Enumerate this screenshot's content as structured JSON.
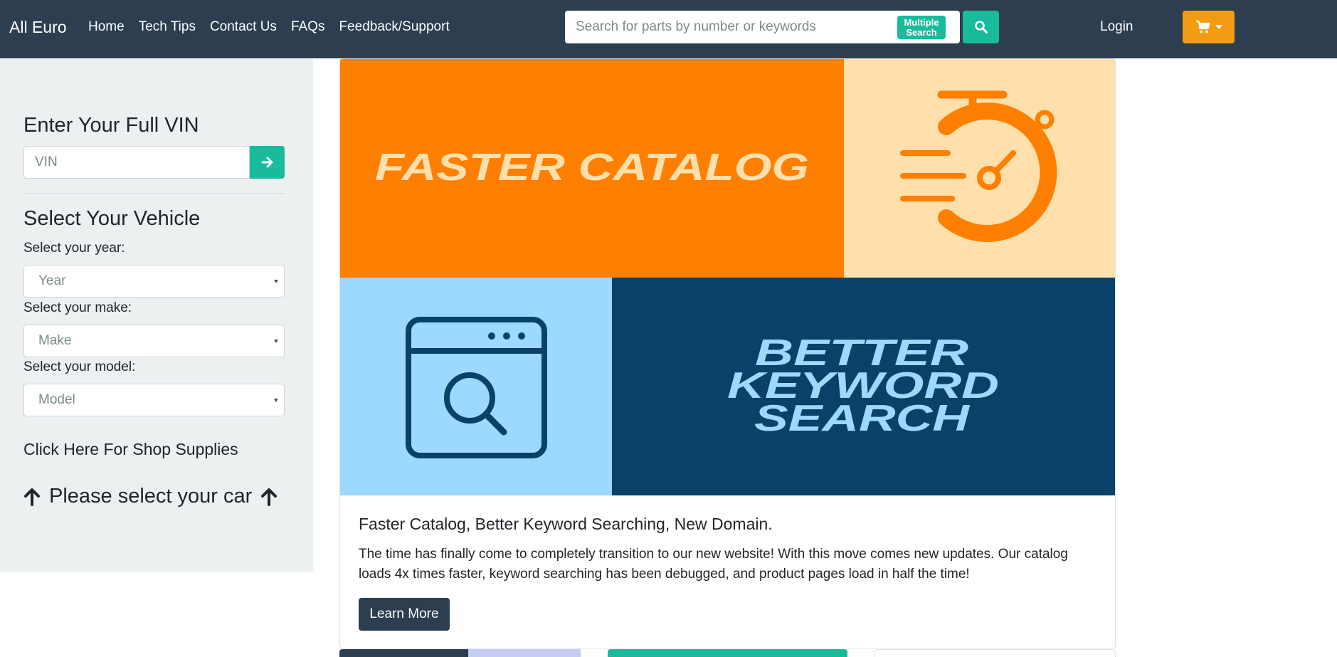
{
  "navbar": {
    "brand": "All Euro",
    "links": [
      "Home",
      "Tech Tips",
      "Contact Us",
      "FAQs",
      "Feedback/Support"
    ],
    "search_placeholder": "Search for parts by number or keywords",
    "multiple_search_line1": "Multiple",
    "multiple_search_line2": "Search",
    "login": "Login",
    "search_icon": "search-icon",
    "cart_icon": "shopping-cart-icon"
  },
  "sidebar": {
    "vin_title": "Enter Your Full VIN",
    "vin_placeholder": "VIN",
    "vehicle_title": "Select Your Vehicle",
    "year_label": "Select your year:",
    "year_value": "Year",
    "make_label": "Select your make:",
    "make_value": "Make",
    "model_label": "Select your model:",
    "model_value": "Model",
    "shop_supplies": "Click Here For Shop Supplies",
    "select_car": "Please select your car"
  },
  "banner": {
    "faster": "FASTER CATALOG",
    "better": "BETTER",
    "keyword": "KEYWORD",
    "search": "SEARCH",
    "colors": {
      "orange": "#ff7f00",
      "peach": "#ffe0ad",
      "light_blue": "#9dd8fe",
      "dark_blue": "#08416a"
    }
  },
  "card": {
    "title": "Faster Catalog, Better Keyword Searching, New Domain.",
    "text": "The time has finally come to completely transition to our new website! With this move comes new updates. Our catalog loads 4x times faster, keyword searching has been debugged, and product pages load in half the time!",
    "button": "Learn More"
  },
  "colors": {
    "navbar": "#2c3e50",
    "success": "#18bc9c",
    "warning": "#f39c12",
    "sidebar_bg": "#ecf0f1"
  }
}
